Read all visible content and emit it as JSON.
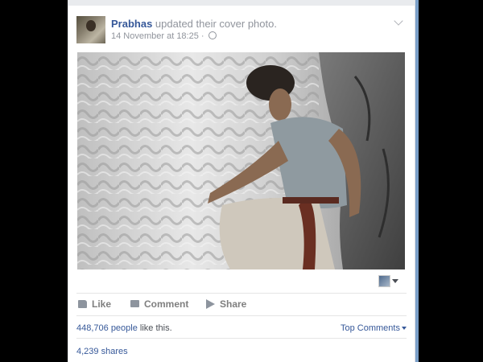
{
  "post": {
    "author": "Prabhas",
    "action_text": " updated their cover photo.",
    "timestamp": "14 November at 18:25 ·",
    "privacy_icon": "globe-icon",
    "menu_icon": "chevron-down-icon"
  },
  "actions": {
    "like": "Like",
    "comment": "Comment",
    "share": "Share"
  },
  "stats": {
    "likes_count": "448,706 people",
    "likes_suffix": " like this.",
    "top_comments": "Top Comments",
    "shares": "4,239 shares"
  },
  "colors": {
    "link": "#365899",
    "muted": "#90949c",
    "accent_strip": "#7a9fc8"
  }
}
